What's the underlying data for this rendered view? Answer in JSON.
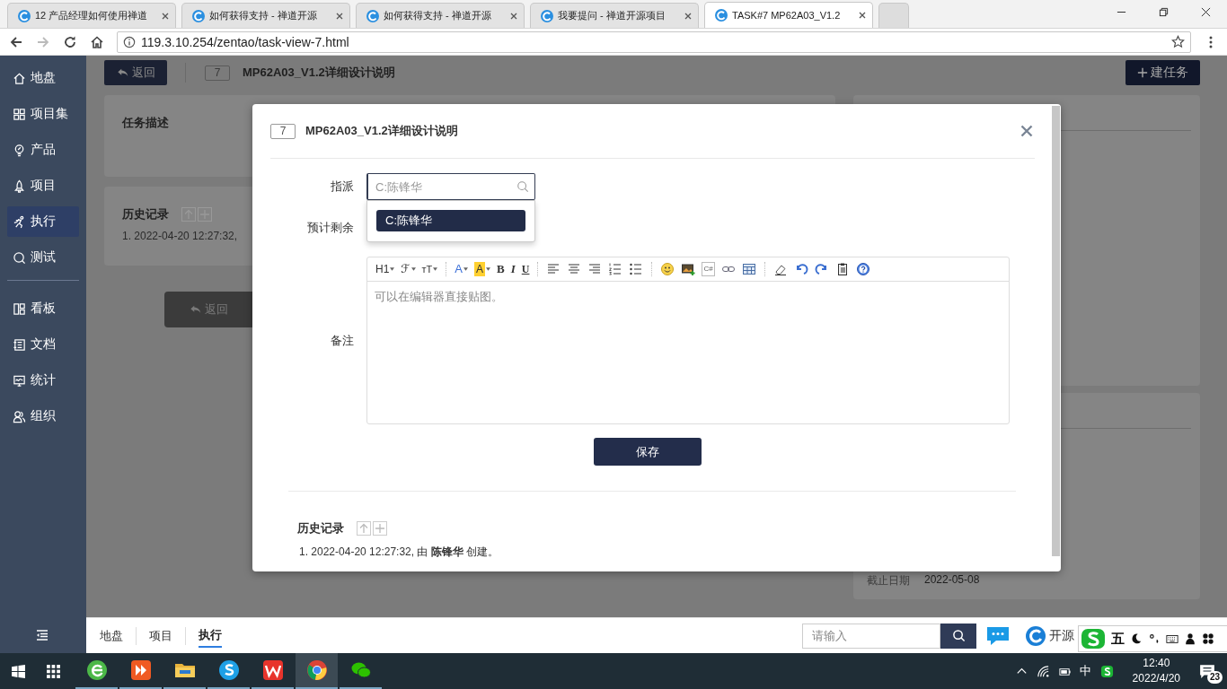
{
  "browser": {
    "tabs": [
      {
        "title": "12 产品经理如何使用禅道",
        "selected": false
      },
      {
        "title": "如何获得支持 - 禅道开源",
        "selected": false
      },
      {
        "title": "如何获得支持 - 禅道开源",
        "selected": false
      },
      {
        "title": "我要提问 - 禅道开源项目",
        "selected": false
      },
      {
        "title": "TASK#7 MP62A03_V1.2",
        "selected": true
      }
    ],
    "url": "119.3.10.254/zentao/task-view-7.html"
  },
  "sidebar": {
    "groups": [
      [
        {
          "label": "地盘",
          "selected": false
        },
        {
          "label": "项目集",
          "selected": false
        },
        {
          "label": "产品",
          "selected": false
        },
        {
          "label": "项目",
          "selected": false
        },
        {
          "label": "执行",
          "selected": true
        },
        {
          "label": "测试",
          "selected": false
        }
      ],
      [
        {
          "label": "看板",
          "selected": false
        },
        {
          "label": "文档",
          "selected": false
        },
        {
          "label": "统计",
          "selected": false
        },
        {
          "label": "组织",
          "selected": false
        }
      ]
    ]
  },
  "page": {
    "back": "返回",
    "task_id": "7",
    "task_title": "MP62A03_V1.2详细设计说明",
    "create_button": "建任务",
    "description_title": "任务描述",
    "history_title": "历史记录",
    "history_entry": "1. 2022-04-20 12:27:32,",
    "bottom_back": "返回",
    "deadline_label": "截止日期",
    "deadline_value": "2022-05-08"
  },
  "modal": {
    "task_id": "7",
    "title": "MP62A03_V1.2详细设计说明",
    "assign_label": "指派",
    "assign_placeholder": "C:陈锋华",
    "options": [
      {
        "label": "C:陈锋华",
        "selected": true
      }
    ],
    "remaining_label": "预计剩余",
    "note_label": "备注",
    "editor_placeholder": "可以在编辑器直接贴图。",
    "toolbar": [
      [
        {
          "kind": "heading",
          "label": "H1"
        },
        {
          "kind": "fontfamily",
          "label": "ℱ"
        },
        {
          "kind": "fontsize",
          "label": "ᴛT"
        }
      ],
      [
        {
          "kind": "forecolor",
          "label": "A"
        },
        {
          "kind": "backcolor",
          "label": "A"
        },
        {
          "kind": "bold",
          "label": "B"
        },
        {
          "kind": "italic",
          "label": "I"
        },
        {
          "kind": "underline",
          "label": "U"
        }
      ],
      [
        {
          "kind": "alignleft"
        },
        {
          "kind": "aligncenter"
        },
        {
          "kind": "alignright"
        },
        {
          "kind": "orderedlist"
        },
        {
          "kind": "unorderedlist"
        }
      ],
      [
        {
          "kind": "emoticons"
        },
        {
          "kind": "image"
        },
        {
          "kind": "code",
          "label": "C#"
        },
        {
          "kind": "link"
        },
        {
          "kind": "table"
        }
      ],
      [
        {
          "kind": "eraser"
        },
        {
          "kind": "undo"
        },
        {
          "kind": "redo"
        },
        {
          "kind": "paste"
        },
        {
          "kind": "help"
        }
      ]
    ],
    "save": "保存",
    "history_title": "历史记录",
    "history": [
      "1. 2022-04-20 12:27:32, 由 **陈锋华** 创建。"
    ]
  },
  "bottom_bar": {
    "crumbs": [
      {
        "label": "地盘",
        "selected": false
      },
      {
        "label": "项目",
        "selected": false
      },
      {
        "label": "执行",
        "selected": true
      }
    ],
    "search_placeholder": "请输入",
    "brand": "开源"
  },
  "ime": {
    "mode": "五"
  },
  "taskbar": {
    "language": "中",
    "time": "12:40",
    "date": "2022/4/20",
    "notifications": "23"
  }
}
